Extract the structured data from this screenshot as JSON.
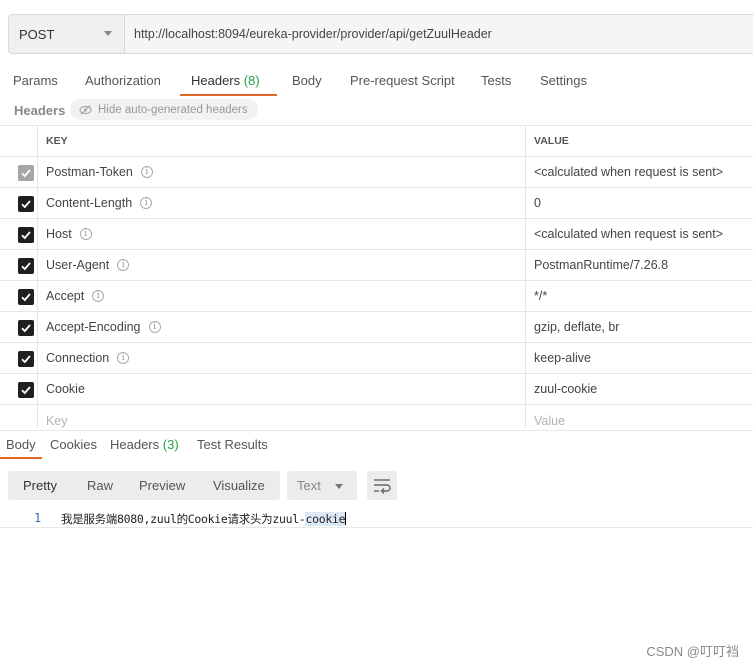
{
  "request": {
    "method": "POST",
    "url": "http://localhost:8094/eureka-provider/provider/api/getZuulHeader"
  },
  "request_tabs": [
    {
      "label": "Params"
    },
    {
      "label": "Authorization"
    },
    {
      "label": "Headers",
      "count": "(8)",
      "active": true
    },
    {
      "label": "Body"
    },
    {
      "label": "Pre-request Script"
    },
    {
      "label": "Tests"
    },
    {
      "label": "Settings"
    }
  ],
  "headers_section": {
    "label": "Headers",
    "toggle_label": "Hide auto-generated headers"
  },
  "table": {
    "key_header": "KEY",
    "value_header": "VALUE",
    "rows": [
      {
        "key": "Postman-Token",
        "value": "<calculated when request is sent>",
        "checked": true,
        "disabled": true,
        "info": true
      },
      {
        "key": "Content-Length",
        "value": "0",
        "checked": true,
        "disabled": false,
        "info": true
      },
      {
        "key": "Host",
        "value": "<calculated when request is sent>",
        "checked": true,
        "disabled": false,
        "info": true
      },
      {
        "key": "User-Agent",
        "value": "PostmanRuntime/7.26.8",
        "checked": true,
        "disabled": false,
        "info": true
      },
      {
        "key": "Accept",
        "value": "*/*",
        "checked": true,
        "disabled": false,
        "info": true
      },
      {
        "key": "Accept-Encoding",
        "value": "gzip, deflate, br",
        "checked": true,
        "disabled": false,
        "info": true
      },
      {
        "key": "Connection",
        "value": "keep-alive",
        "checked": true,
        "disabled": false,
        "info": true
      },
      {
        "key": "Cookie",
        "value": "zuul-cookie",
        "checked": true,
        "disabled": false,
        "info": false
      }
    ],
    "new_key_placeholder": "Key",
    "new_value_placeholder": "Value"
  },
  "response_tabs": [
    {
      "label": "Body",
      "active": true
    },
    {
      "label": "Cookies"
    },
    {
      "label": "Headers",
      "count": "(3)"
    },
    {
      "label": "Test Results"
    }
  ],
  "response_toolbar": {
    "views": [
      "Pretty",
      "Raw",
      "Preview",
      "Visualize"
    ],
    "active_view": "Pretty",
    "format": "Text",
    "wrap_icon": "wrap-lines-icon"
  },
  "response_body": {
    "line_number": "1",
    "text_before": "我是服务端8080,zuul的Cookie请求头为zuul-",
    "text_highlight": "cookie"
  },
  "watermark": "CSDN @叮叮裆",
  "colors": {
    "accent": "#e0672a",
    "count_green": "#24a148",
    "checkbox": "#1f1f1f",
    "checkbox_disabled": "#a6a6a6",
    "line_number": "#3a6fb4"
  }
}
